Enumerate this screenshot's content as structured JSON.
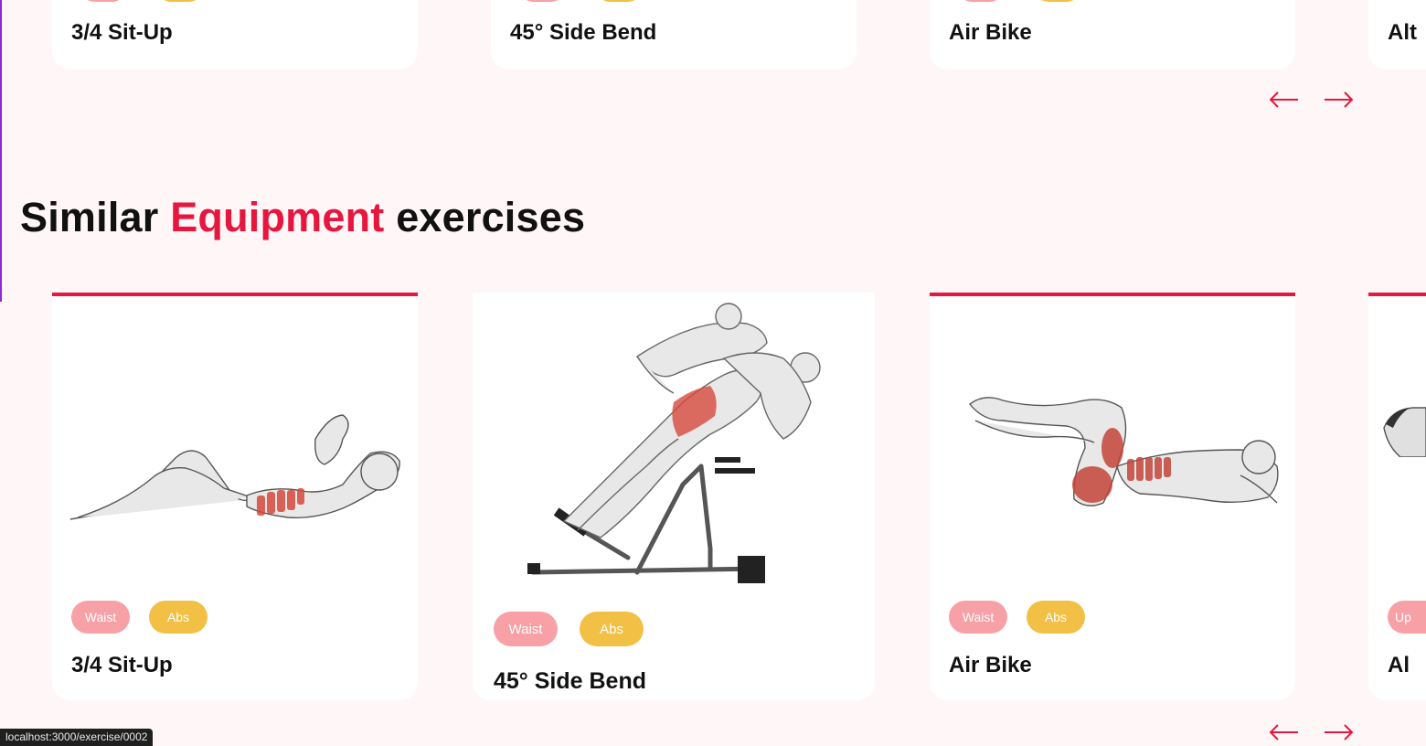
{
  "top_row": {
    "cards": [
      {
        "name": "3/4 Sit-Up"
      },
      {
        "name": "45° Side Bend"
      },
      {
        "name": "Air Bike"
      },
      {
        "name": "Alt"
      }
    ],
    "prev_icon": "arrow-left-icon",
    "next_icon": "arrow-right-icon"
  },
  "section": {
    "title_prefix": "Similar",
    "title_accent": "Equipment",
    "title_suffix": "exercises"
  },
  "cards": [
    {
      "name": "3/4 Sit-Up",
      "tags": [
        "Waist",
        "Abs"
      ],
      "illustration": "situp-illustration"
    },
    {
      "name": "45° Side Bend",
      "tags": [
        "Waist",
        "Abs"
      ],
      "illustration": "side-bend-illustration"
    },
    {
      "name": "Air Bike",
      "tags": [
        "Waist",
        "Abs"
      ],
      "illustration": "air-bike-illustration"
    },
    {
      "name": "Al",
      "tags": [
        "Up"
      ],
      "illustration": "partial-illustration"
    }
  ],
  "colors": {
    "accent": "#e6163f",
    "waist_tag": "#f7a1a6",
    "abs_tag": "#f2c045",
    "background": "#fff7f7"
  },
  "status_url": "localhost:3000/exercise/0002"
}
